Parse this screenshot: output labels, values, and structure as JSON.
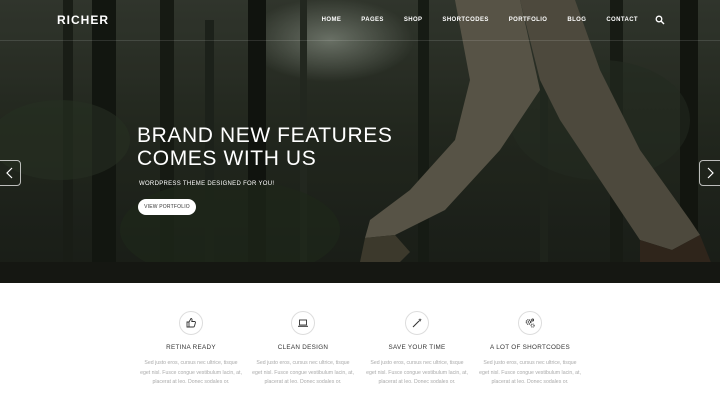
{
  "brand": {
    "logo": "RICHER"
  },
  "nav": {
    "items": [
      "HOME",
      "PAGES",
      "SHOP",
      "SHORTCODES",
      "PORTFOLIO",
      "BLOG",
      "CONTACT"
    ],
    "search_icon": "search-icon"
  },
  "hero": {
    "headline_line1": "BRAND NEW FEATURES",
    "headline_line2": "COMES WITH US",
    "subline": "WORDPRESS THEME DESIGNED FOR YOU!",
    "cta_label": "VIEW PORTFOLIO",
    "prev_icon": "chevron-left-icon",
    "next_icon": "chevron-right-icon"
  },
  "features": [
    {
      "title": "RETINA READY",
      "icon": "thumbs-up-icon",
      "desc_line1": "Sed justo eros, cursus nec ultrice, tisque",
      "desc_line2": "eget nisl. Fusce congue vestibulum lacin, at,",
      "desc_line3": "placerat at leo. Donec sodales or."
    },
    {
      "title": "CLEAN DESIGN",
      "icon": "laptop-icon",
      "desc_line1": "Sed justo eros, cursus nec ultrice, tisque",
      "desc_line2": "eget nisl. Fusce congue vestibulum lacin, at,",
      "desc_line3": "placerat at leo. Donec sodales or."
    },
    {
      "title": "SAVE YOUR TIME",
      "icon": "magic-wand-icon",
      "desc_line1": "Sed justo eros, cursus nec ultrice, tisque",
      "desc_line2": "eget nisl. Fusce congue vestibulum lacin, at,",
      "desc_line3": "placerat at leo. Donec sodales or."
    },
    {
      "title": "A LOT OF SHORTCODES",
      "icon": "gears-icon",
      "desc_line1": "Sed justo eros, cursus nec ultrice, tisque",
      "desc_line2": "eget nisl. Fusce congue vestibulum lacin, at,",
      "desc_line3": "placerat at leo. Donec sodales or."
    }
  ],
  "colors": {
    "hero_dark": "#2a3025",
    "text_dark": "#333333",
    "text_muted": "#aaaaaa",
    "accent_white": "#ffffff"
  }
}
